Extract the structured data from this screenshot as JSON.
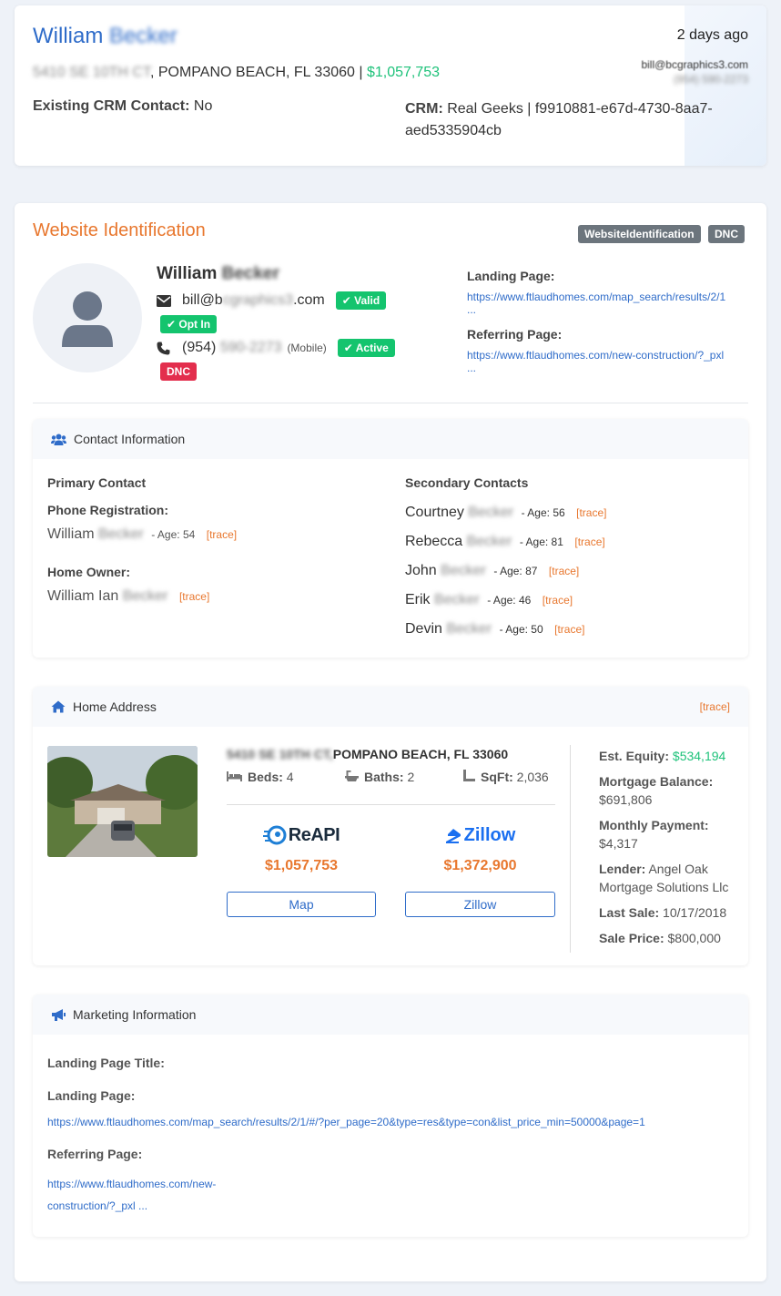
{
  "top": {
    "first_name": "William",
    "last_name": "Becker",
    "time_ago": "2 days ago",
    "street": "5410 SE 10TH CT",
    "city_line": ", POMPANO BEACH, FL 33060 |",
    "price": "$1,057,753",
    "email_right": "bill@bcgraphics3.com",
    "phone_right": "(954) 590-2273",
    "crm_contact_label": "Existing CRM Contact:",
    "crm_contact_value": "No",
    "crm_label": "CRM:",
    "crm_value_line1": "Real Geeks | f9910881-e67d-4730-8aa7-",
    "crm_value_line2": "aed5335904cb"
  },
  "website": {
    "title": "Website Identification",
    "badge1": "WebsiteIdentification",
    "badge2": "DNC",
    "first_name": "William",
    "last_name": "Becker",
    "email_user": "bill@b",
    "email_blur": "cgraphics3",
    "email_tld": ".com",
    "valid_label": "Valid",
    "optin_label": "Opt In",
    "phone_area": "(954)",
    "phone_blur": "590-2273",
    "phone_type": "(Mobile)",
    "active_label": "Active",
    "dnc_label": "DNC",
    "landing_label": "Landing Page:",
    "landing_url": "https://www.ftlaudhomes.com/map_search/results/2/1",
    "landing_more": "...",
    "referring_label": "Referring Page:",
    "referring_url": "https://www.ftlaudhomes.com/new-construction/?_pxl",
    "referring_more": "..."
  },
  "contact": {
    "title": "Contact Information",
    "primary_title": "Primary Contact",
    "phone_reg_label": "Phone Registration:",
    "phone_reg_first": "William",
    "phone_reg_last": "Becker",
    "phone_reg_age": "- Age: 54",
    "home_owner_label": "Home Owner:",
    "home_owner_first": "William Ian",
    "home_owner_last": "Becker",
    "trace": "[trace]",
    "secondary_title": "Secondary Contacts",
    "secondary": [
      {
        "first": "Courtney",
        "last": "Becker",
        "age": "- Age: 56"
      },
      {
        "first": "Rebecca",
        "last": "Becker",
        "age": "- Age: 81"
      },
      {
        "first": "John",
        "last": "Becker",
        "age": "- Age: 87"
      },
      {
        "first": "Erik",
        "last": "Becker",
        "age": "- Age: 46"
      },
      {
        "first": "Devin",
        "last": "Becker",
        "age": "- Age: 50"
      }
    ]
  },
  "home": {
    "title": "Home Address",
    "trace": "[trace]",
    "street": "5410 SE 10TH CT,",
    "city": "POMPANO BEACH, FL 33060",
    "beds_label": "Beds:",
    "beds": "4",
    "baths_label": "Baths:",
    "baths": "2",
    "sqft_label": "SqFt:",
    "sqft": "2,036",
    "reapi_logo": "ReAPI",
    "reapi_value": "$1,057,753",
    "zillow_logo": "Zillow",
    "zillow_value": "$1,372,900",
    "map_button": "Map",
    "zillow_button": "Zillow",
    "equity_label": "Est. Equity:",
    "equity": "$534,194",
    "mortgage_label": "Mortgage Balance:",
    "mortgage": "$691,806",
    "payment_label": "Monthly Payment:",
    "payment": "$4,317",
    "lender_label": "Lender:",
    "lender_line1": "Angel Oak",
    "lender_line2": "Mortgage Solutions Llc",
    "last_sale_label": "Last Sale:",
    "last_sale": "10/17/2018",
    "sale_price_label": "Sale Price:",
    "sale_price": "$800,000"
  },
  "marketing": {
    "title": "Marketing Information",
    "landing_title_label": "Landing Page Title:",
    "landing_label": "Landing Page:",
    "landing_url": "https://www.ftlaudhomes.com/map_search/results/2/1/#/?per_page=20&type=res&type=con&list_price_min=50000&page=1",
    "referring_label": "Referring Page:",
    "referring_line1": "https://www.ftlaudhomes.com/new-",
    "referring_line2": "construction/?_pxl ..."
  }
}
